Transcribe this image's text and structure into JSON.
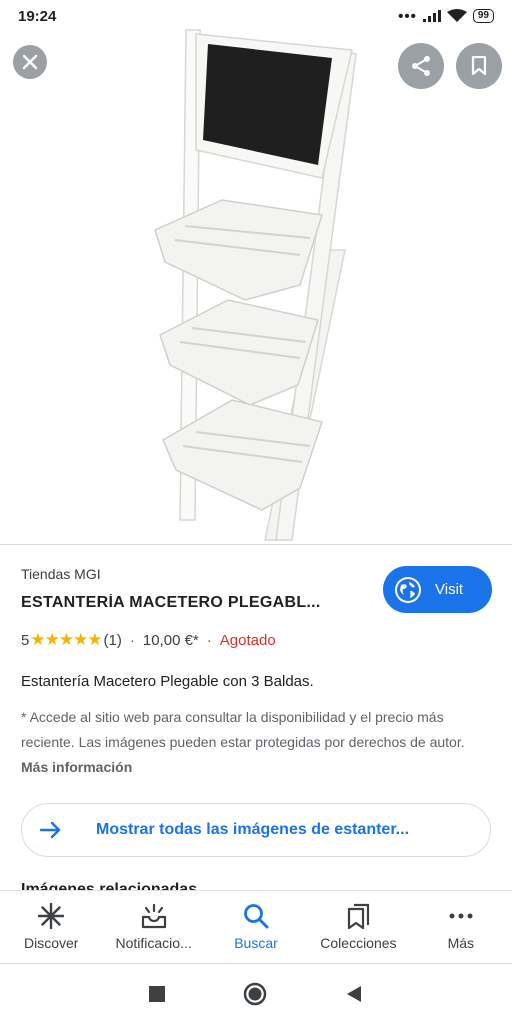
{
  "status_bar": {
    "time": "19:24",
    "battery": "99"
  },
  "viewer": {
    "close_icon": "close-icon",
    "share_icon": "share-icon",
    "save_icon": "bookmark-icon"
  },
  "result": {
    "source": "Tiendas MGI",
    "title": "ESTANTERÍA MACETERO PLEGABL...",
    "visit_label": "Visit",
    "rating": "5",
    "rating_stars": 5,
    "review_count": "(1)",
    "price": "10,00 €*",
    "stock_status": "Agotado",
    "description": "Estantería Macetero Plegable con 3 Baldas.",
    "disclaimer": "* Accede al sitio web para consultar la disponibilidad y el precio más reciente. Las imágenes pueden estar protegidas por derechos de autor.",
    "more_info": "Más información",
    "show_all_images": "Mostrar todas las imágenes de estanter...",
    "related_heading": "Imágenes relacionadas"
  },
  "bottom_nav": {
    "items": [
      {
        "label": "Discover",
        "icon": "asterisk-icon"
      },
      {
        "label": "Notificacio...",
        "icon": "notifications-icon"
      },
      {
        "label": "Buscar",
        "icon": "search-icon",
        "active": true
      },
      {
        "label": "Colecciones",
        "icon": "collections-icon"
      },
      {
        "label": "Más",
        "icon": "more-icon"
      }
    ]
  },
  "colors": {
    "accent": "#1a73e8",
    "star": "#f4b400",
    "out_of_stock": "#d93025"
  }
}
